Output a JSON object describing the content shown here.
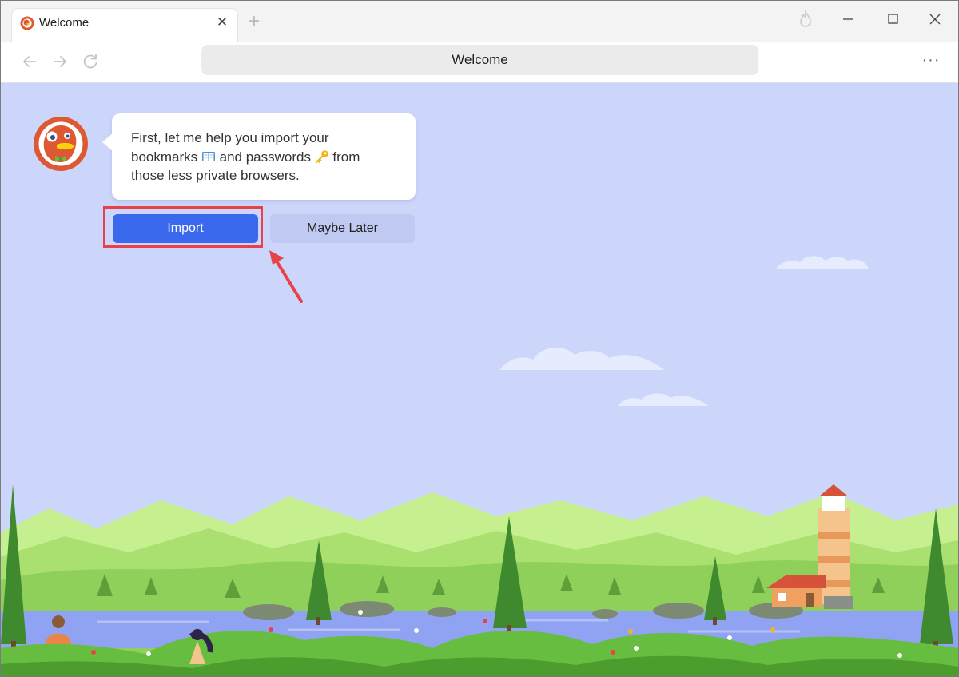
{
  "tab": {
    "title": "Welcome",
    "close_icon": "close-icon"
  },
  "toolbar": {
    "url": "Welcome"
  },
  "welcome": {
    "message_line1": "First, let me help you import your",
    "message_line2_a": "bookmarks",
    "message_line2_b": "and passwords",
    "message_line2_c": "from",
    "message_line3": "those less private browsers.",
    "import_label": "Import",
    "later_label": "Maybe Later"
  },
  "colors": {
    "sky": "#ccd6fb",
    "accent": "#3a69ee",
    "secondary_button": "#bfc9f2",
    "highlight": "#e8414a",
    "brand": "#de5833"
  }
}
